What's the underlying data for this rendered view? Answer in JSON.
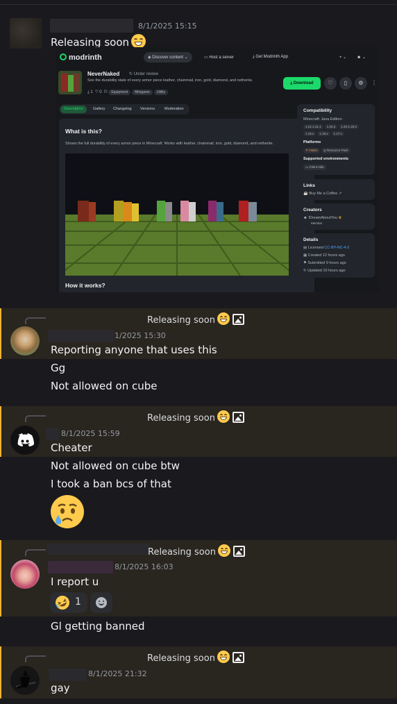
{
  "messages": [
    {
      "id": "m1",
      "timestamp": "8/1/2025 15:15",
      "text": "Releasing soon",
      "emoji": "grinning-face-icon"
    },
    {
      "id": "m2",
      "reply_to": "Releasing soon",
      "timestamp": "1/2025 15:30",
      "lines": [
        "Reporting anyone that uses this",
        "Gg",
        "Not allowed on cube"
      ]
    },
    {
      "id": "m3",
      "reply_to": "Releasing soon",
      "timestamp": "8/1/2025 15:59",
      "lines": [
        "Cheater",
        "Not allowed on cube btw",
        "I took a ban bcs of that"
      ],
      "big_emoji": "crying-face-icon"
    },
    {
      "id": "m4",
      "reply_to": "Releasing soon",
      "timestamp": "8/1/2025 16:03",
      "lines": [
        "I report u"
      ],
      "reaction_count": "1",
      "followup": "Gl getting banned"
    },
    {
      "id": "m5",
      "reply_to": "Releasing soon",
      "timestamp": "8/1/2025 21:32",
      "lines": [
        "gay"
      ]
    }
  ],
  "embed": {
    "brand": "modrinth",
    "nav": [
      "Discover content",
      "Host a server",
      "Get Modrinth App"
    ],
    "project": {
      "title": "NeverNaked",
      "status": "Under review",
      "description": "See the durability state of every armor piece leather, chainmail, iron, gold, diamond, and netherite.",
      "downloads": "1",
      "follows": "0",
      "tags": [
        "Equipment",
        "Minigame",
        "Utility"
      ],
      "download_label": "Download"
    },
    "tabs": [
      "Description",
      "Gallery",
      "Changelog",
      "Versions",
      "Moderation"
    ],
    "body": {
      "heading": "What is this?",
      "text": "Shows the full durability of every armor piece in Minecraft. Works with leather, chainmail, iron, gold, diamond, and netherite.",
      "heading2": "How it works?"
    },
    "sidebar": {
      "compat_title": "Compatibility",
      "compat_edition": "Minecraft: Java Edition",
      "versions": [
        "1.21-1.21.1",
        "1.20.4",
        "1.20-1.20.2",
        "1.19.x",
        "1.18.x",
        "1.17.x"
      ],
      "platforms_title": "Platforms",
      "platforms": [
        "Fabric",
        "Resource Pack"
      ],
      "env_title": "Supported environments",
      "env": "Client-side",
      "links_title": "Links",
      "link": "Buy Me a Coffee",
      "creators_title": "Creators",
      "creator": "IDreamAboutYou",
      "creator_role": "Member",
      "details_title": "Details",
      "license_label": "Licensed",
      "license": "CC-BY-NC-4.0",
      "created": "Created 12 hours ago",
      "submitted": "Submitted 9 hours ago",
      "updated": "Updated 10 hours ago"
    }
  },
  "colors": {
    "background": "#1a1a1e",
    "reply_highlight": "#29251f",
    "reply_bar": "#f0b232",
    "modrinth_green": "#1bd96a"
  }
}
